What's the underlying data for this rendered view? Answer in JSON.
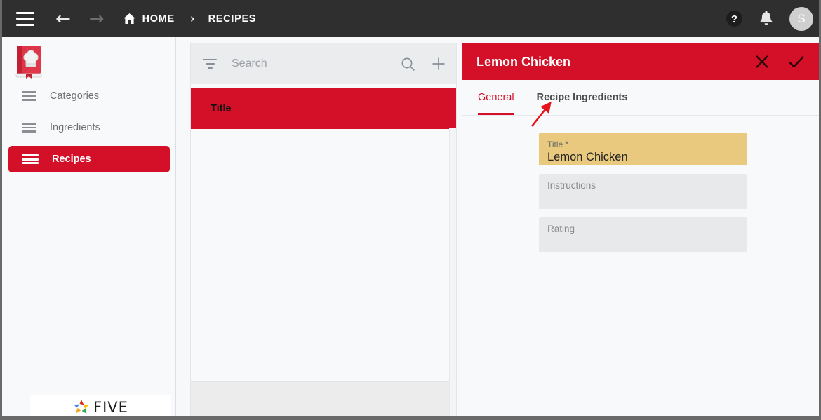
{
  "topbar": {
    "menu_icon": "hamburger-icon",
    "back_icon": "arrow-left-icon",
    "forward_icon": "arrow-right-icon",
    "home_icon": "home-icon",
    "breadcrumb": [
      {
        "label": "HOME"
      },
      {
        "label": "RECIPES"
      }
    ],
    "separator": "›",
    "help_icon": "help-circle-icon",
    "notifications_icon": "bell-icon",
    "avatar_initial": "S"
  },
  "sidebar": {
    "logo_icon": "cookbook-icon",
    "items": [
      {
        "label": "Categories",
        "icon": "list-icon",
        "active": false
      },
      {
        "label": "Ingredients",
        "icon": "list-icon",
        "active": false
      },
      {
        "label": "Recipes",
        "icon": "list-icon",
        "active": true
      }
    ],
    "brand": {
      "name": "FIVE",
      "logo_icon": "five-pinwheel-icon"
    }
  },
  "list_panel": {
    "search": {
      "placeholder": "Search",
      "value": "",
      "filter_icon": "filter-icon",
      "search_icon": "search-icon",
      "add_icon": "plus-icon"
    },
    "columns": [
      {
        "label": "Title"
      }
    ],
    "rows": []
  },
  "detail_panel": {
    "title": "Lemon Chicken",
    "close_icon": "close-icon",
    "confirm_icon": "check-icon",
    "tabs": [
      {
        "label": "General",
        "active": true
      },
      {
        "label": "Recipe Ingredients",
        "active": false
      }
    ],
    "fields": [
      {
        "label": "Title *",
        "value": "Lemon Chicken",
        "state": "focused"
      },
      {
        "label": "Instructions",
        "value": "",
        "state": "normal"
      },
      {
        "label": "Rating",
        "value": "",
        "state": "normal"
      }
    ]
  },
  "annotation": {
    "arrow_color": "#e8121b",
    "points_to": "Recipe Ingredients"
  },
  "colors": {
    "brand_red": "#d31027",
    "topbar_dark": "#2f2f2f",
    "field_focus": "#e9c97e",
    "field_idle": "#e8e9ea"
  }
}
